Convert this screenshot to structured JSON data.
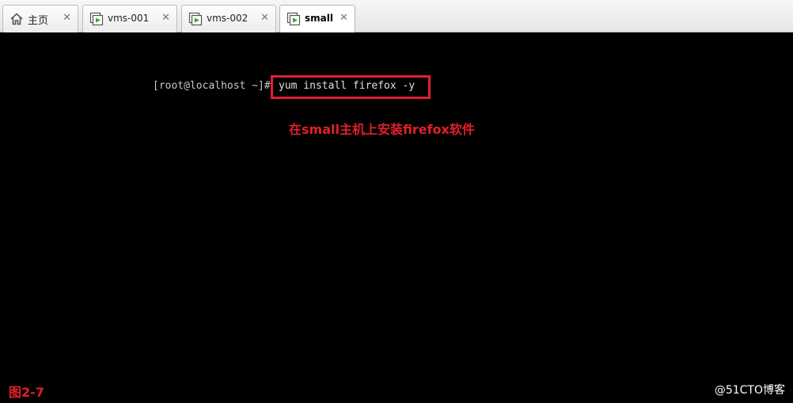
{
  "tabs": [
    {
      "label": "主页",
      "icon": "home-icon",
      "active": false
    },
    {
      "label": "vms-001",
      "icon": "vm-icon",
      "active": false
    },
    {
      "label": "vms-002",
      "icon": "vm-icon",
      "active": false
    },
    {
      "label": "small",
      "icon": "vm-icon",
      "active": true
    }
  ],
  "tab_close_glyph": "✕",
  "console": {
    "prompt": "[root@localhost ~]#",
    "command": "yum install firefox -y"
  },
  "annotation": {
    "text": "在small主机上安装firefox软件",
    "color": "#e0202a"
  },
  "figure_label": "图2-7",
  "watermark": "@51CTO博客"
}
